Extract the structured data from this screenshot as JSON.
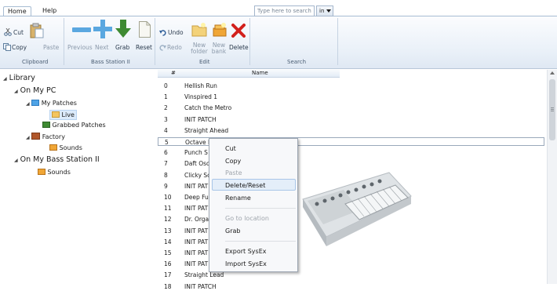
{
  "tabs": {
    "home": "Home",
    "help": "Help"
  },
  "clipboard": {
    "cut": "Cut",
    "copy": "Copy",
    "paste": "Paste",
    "label": "Clipboard"
  },
  "bass_station": {
    "previous": "Previous",
    "next": "Next",
    "grab": "Grab",
    "reset": "Reset",
    "label": "Bass Station II"
  },
  "edit": {
    "undo": "Undo",
    "redo": "Redo",
    "new_folder": "New folder",
    "new_bank": "New bank",
    "delete": "Delete",
    "label": "Edit"
  },
  "search": {
    "placeholder": "Type here to search",
    "scope": "in",
    "label": "Search"
  },
  "tree": {
    "library": "Library",
    "on_my_pc": "On My PC",
    "my_patches": "My Patches",
    "live": "Live",
    "grabbed_patches": "Grabbed Patches",
    "factory": "Factory",
    "factory_sounds": "Sounds",
    "on_bass_station": "On My Bass Station II",
    "bs_sounds": "Sounds"
  },
  "list": {
    "col_num": "#",
    "col_name": "Name",
    "rows": [
      {
        "n": "0",
        "name": "Hellish Run"
      },
      {
        "n": "1",
        "name": "Vinspired 1"
      },
      {
        "n": "2",
        "name": "Catch the Metro"
      },
      {
        "n": "3",
        "name": "INIT PATCH"
      },
      {
        "n": "4",
        "name": "Straight Ahead"
      },
      {
        "n": "5",
        "name": "Octave L"
      },
      {
        "n": "6",
        "name": "Punch S"
      },
      {
        "n": "7",
        "name": "Daft Osc"
      },
      {
        "n": "8",
        "name": "Clicky Sc"
      },
      {
        "n": "9",
        "name": "INIT PAT"
      },
      {
        "n": "10",
        "name": "Deep Fu"
      },
      {
        "n": "11",
        "name": "INIT PAT"
      },
      {
        "n": "12",
        "name": "Dr. Orga"
      },
      {
        "n": "13",
        "name": "INIT PAT"
      },
      {
        "n": "14",
        "name": "INIT PAT"
      },
      {
        "n": "15",
        "name": "INIT PAT"
      },
      {
        "n": "16",
        "name": "INIT PAT"
      },
      {
        "n": "17",
        "name": "Straight Lead"
      },
      {
        "n": "18",
        "name": "INIT PATCH"
      }
    ]
  },
  "context_menu": {
    "cut": "Cut",
    "copy": "Copy",
    "paste": "Paste",
    "delete_reset": "Delete/Reset",
    "rename": "Rename",
    "go_to_location": "Go to location",
    "grab": "Grab",
    "export_sysex": "Export SysEx",
    "import_sysex": "Import SysEx"
  }
}
